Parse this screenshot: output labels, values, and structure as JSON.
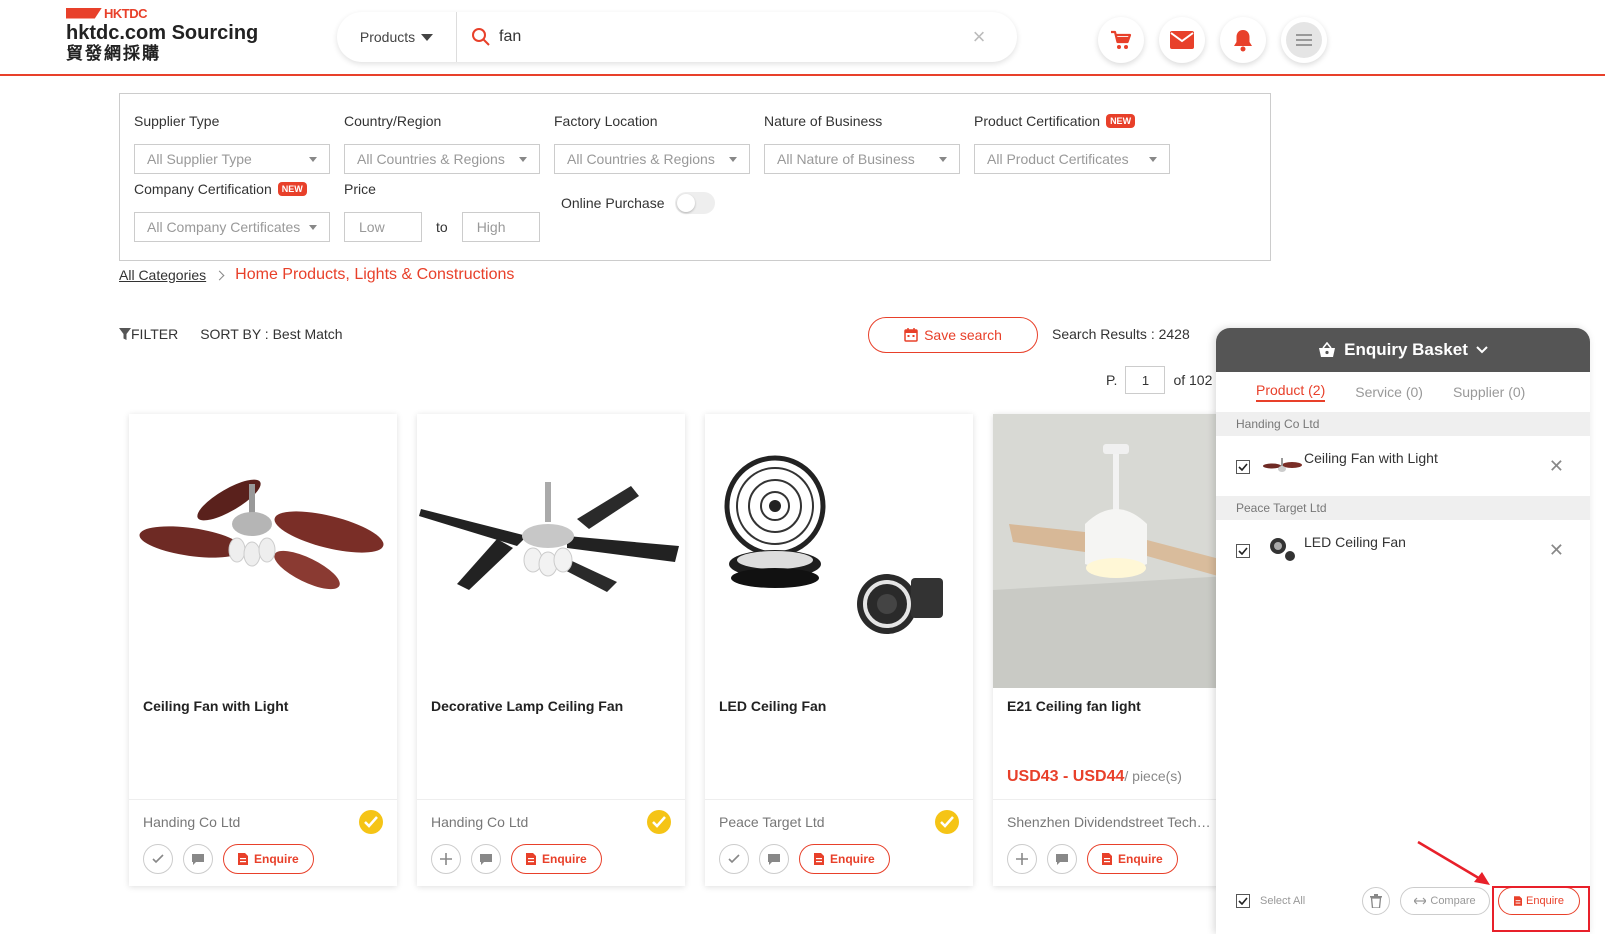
{
  "brand": {
    "top": "HKTDC",
    "main": "hktdc.com Sourcing",
    "sub": "貿發網採購",
    "accent": "#e8402a"
  },
  "search": {
    "category": "Products",
    "query": "fan",
    "clear": "×"
  },
  "header_icons": [
    "cart-icon",
    "mail-icon",
    "bell-icon",
    "menu-icon"
  ],
  "filters": {
    "supplier_type": {
      "label": "Supplier Type",
      "value": "All Supplier Type"
    },
    "country_region": {
      "label": "Country/Region",
      "value": "All Countries & Regions"
    },
    "factory_location": {
      "label": "Factory Location",
      "value": "All Countries & Regions"
    },
    "nature_of_business": {
      "label": "Nature of Business",
      "value": "All Nature of Business"
    },
    "product_certification": {
      "label": "Product Certification",
      "badge": "NEW",
      "value": "All Product Certificates"
    },
    "company_certification": {
      "label": "Company Certification",
      "badge": "NEW",
      "value": "All Company Certificates"
    },
    "price": {
      "label": "Price",
      "low": "Low",
      "to": "to",
      "high": "High"
    },
    "online_purchase": {
      "label": "Online Purchase",
      "on": false
    }
  },
  "breadcrumb": {
    "root": "All Categories",
    "current": "Home Products, Lights & Constructions"
  },
  "toolbar": {
    "filter": "FILTER",
    "sort": "SORT BY : Best Match",
    "save_search": "Save search",
    "results": "Search Results : 2428",
    "page_prefix": "P.",
    "page": "1",
    "page_total": "of 102"
  },
  "products": [
    {
      "title": "Ceiling Fan with Light",
      "supplier": "Handing Co Ltd",
      "price": "",
      "unit": "",
      "verified": true,
      "added": true,
      "enquire": "Enquire"
    },
    {
      "title": "Decorative Lamp Ceiling Fan",
      "supplier": "Handing Co Ltd",
      "price": "",
      "unit": "",
      "verified": true,
      "added": false,
      "enquire": "Enquire"
    },
    {
      "title": "LED Ceiling Fan",
      "supplier": "Peace Target Ltd",
      "price": "",
      "unit": "",
      "verified": true,
      "added": true,
      "enquire": "Enquire"
    },
    {
      "title": "E21 Ceiling fan light",
      "supplier": "Shenzhen Dividendstreet Technology",
      "price": "USD43 - USD44",
      "unit": "/ piece(s)",
      "verified": false,
      "added": false,
      "enquire": "Enquire"
    }
  ],
  "basket": {
    "title": "Enquiry Basket",
    "tabs": [
      "Product (2)",
      "Service (0)",
      "Supplier (0)"
    ],
    "groups": [
      {
        "supplier": "Handing Co Ltd",
        "items": [
          {
            "name": "Ceiling Fan with Light",
            "checked": true
          }
        ]
      },
      {
        "supplier": "Peace Target Ltd",
        "items": [
          {
            "name": "LED Ceiling Fan",
            "checked": true
          }
        ]
      }
    ],
    "select_all": "Select All",
    "compare": "Compare",
    "enquire": "Enquire"
  }
}
